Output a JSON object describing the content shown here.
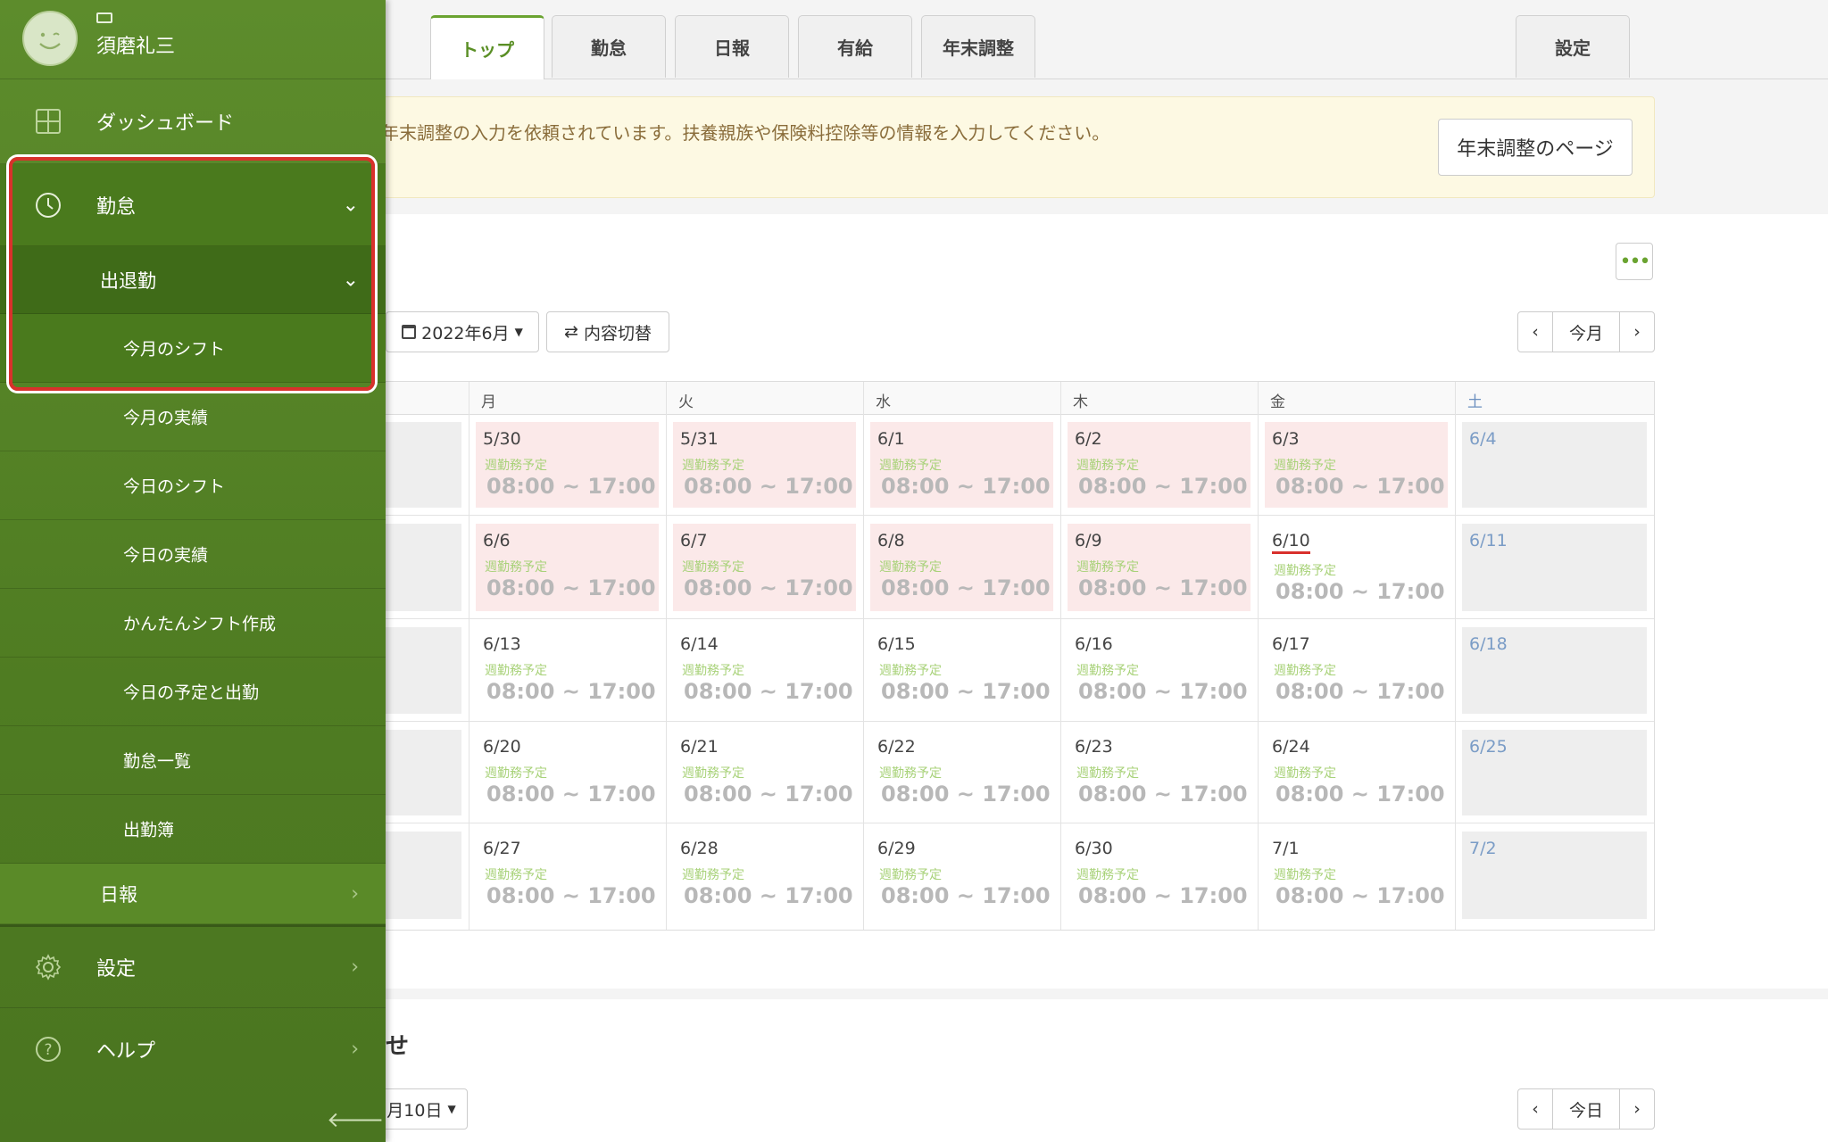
{
  "tabs": [
    {
      "label": "トップ",
      "active": true
    },
    {
      "label": "勤怠"
    },
    {
      "label": "日報"
    },
    {
      "label": "有給"
    },
    {
      "label": "年末調整"
    },
    {
      "label": "設定"
    }
  ],
  "notice": {
    "text": "年末調整の入力を依頼されています。扶養親族や保険料控除等の情報を入力してください。",
    "button": "年末調整のページ"
  },
  "calendar": {
    "month_label": "2022年6月",
    "toggle_label": "内容切替",
    "prev": "‹",
    "current": "今月",
    "next": "›",
    "more": "•••",
    "weekdays": [
      "月",
      "火",
      "水",
      "木",
      "金",
      "土"
    ],
    "shift_label": "週勤務予定",
    "shift_time": "08:00 ~ 17:00",
    "weeks": [
      [
        "5/30",
        "5/31",
        "6/1",
        "6/2",
        "6/3",
        "6/4"
      ],
      [
        "6/6",
        "6/7",
        "6/8",
        "6/9",
        "6/10",
        "6/11"
      ],
      [
        "6/13",
        "6/14",
        "6/15",
        "6/16",
        "6/17",
        "6/18"
      ],
      [
        "6/20",
        "6/21",
        "6/22",
        "6/23",
        "6/24",
        "6/25"
      ],
      [
        "6/27",
        "6/28",
        "6/29",
        "6/30",
        "7/1",
        "7/2"
      ]
    ],
    "today": "6/10"
  },
  "section2": {
    "title": "せ",
    "date_label": "月10日",
    "prev": "‹",
    "current": "今日",
    "next": "›"
  },
  "sidebar": {
    "username": "須磨礼三",
    "dashboard": "ダッシュボード",
    "attendance": "勤怠",
    "clock_in_out": "出退勤",
    "sub_items": [
      "今月のシフト",
      "今月の実績",
      "今日のシフト",
      "今日の実績",
      "かんたんシフト作成",
      "今日の予定と出勤",
      "勤怠一覧",
      "出勤簿"
    ],
    "daily_report": "日報",
    "settings": "設定",
    "help": "ヘルプ"
  },
  "colors": {
    "sidebar_green": "#5d8c2c",
    "accent_green": "#6aa330",
    "highlight_red": "#d8312b",
    "scheduled_pink": "#fbe9e9"
  }
}
